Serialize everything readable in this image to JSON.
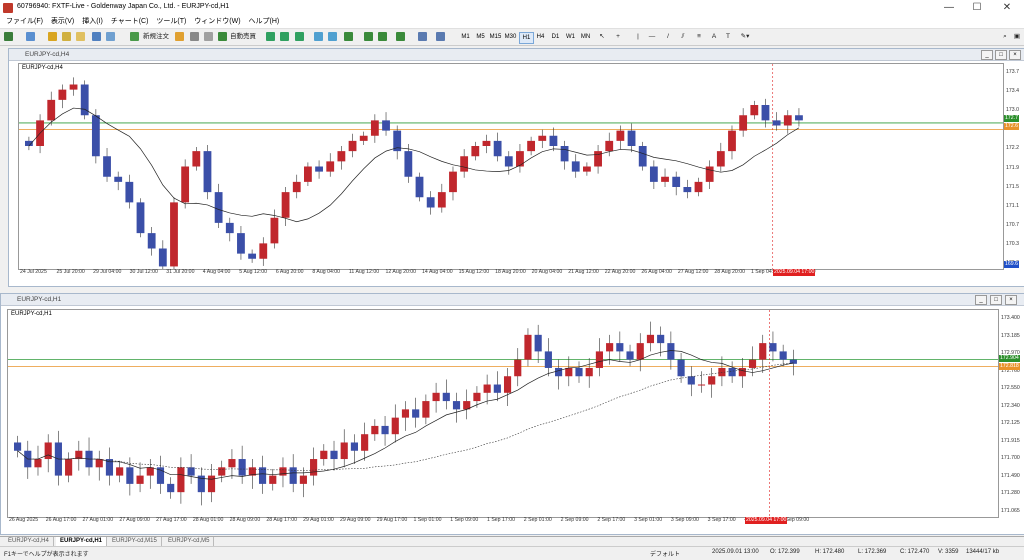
{
  "window": {
    "title": "60796940: FXTF-Live - Goldenway Japan Co., Ltd. - EURJPY-cd,H1"
  },
  "menu": [
    "ファイル(F)",
    "表示(V)",
    "挿入(I)",
    "チャート(C)",
    "ツール(T)",
    "ウィンドウ(W)",
    "ヘルプ(H)"
  ],
  "toolbar": {
    "new_order": "新規注文",
    "auto_trade": "自動売買",
    "timeframes": [
      "M1",
      "M5",
      "M15",
      "M30",
      "H1",
      "H4",
      "D1",
      "W1",
      "MN"
    ],
    "active_tf": "H1"
  },
  "colors": {
    "bull": "#c0272d",
    "bear": "#3b4fa8",
    "ma": "#222222",
    "green_line": "#2e9b3a",
    "orange_line": "#e8932b",
    "red_tag": "#e02020",
    "green_tag": "#2c8f2c",
    "blue_tag": "#2050c8"
  },
  "chart_top": {
    "window_title": "EURJPY-cd,H4",
    "label": "EURJPY-cd,H4",
    "y_ticks": [
      "173.7",
      "173.4",
      "173.0",
      "172.6",
      "172.2",
      "171.9",
      "171.5",
      "171.1",
      "170.7",
      "170.3",
      "170.0"
    ],
    "x_ticks": [
      "24 Jul 2025",
      "25 Jul 20:00",
      "29 Jul 04:00",
      "30 Jul 12:00",
      "31 Jul 20:00",
      "4 Aug 04:00",
      "5 Aug 12:00",
      "6 Aug 20:00",
      "8 Aug 04:00",
      "11 Aug 12:00",
      "12 Aug 20:00",
      "14 Aug 04:00",
      "15 Aug 12:00",
      "18 Aug 20:00",
      "20 Aug 04:00",
      "21 Aug 12:00",
      "22 Aug 20:00",
      "26 Aug 04:00",
      "27 Aug 12:00",
      "28 Aug 20:00",
      "1 Sep 04:00",
      "2 Sep 12:00"
    ],
    "time_tag": "2025.09.04 17:00",
    "price_green": "172.7",
    "price_orange": "172.6",
    "price_blue": "169.6",
    "chart_data": {
      "type": "candlestick",
      "ylim": [
        169.9,
        173.9
      ],
      "close": [
        172.3,
        172.8,
        173.2,
        173.4,
        173.5,
        172.9,
        172.1,
        171.7,
        171.6,
        171.2,
        170.6,
        170.3,
        169.95,
        171.2,
        171.9,
        172.2,
        171.4,
        170.8,
        170.6,
        170.2,
        170.1,
        170.4,
        170.9,
        171.4,
        171.6,
        171.9,
        171.8,
        172.0,
        172.2,
        172.4,
        172.5,
        172.8,
        172.6,
        172.2,
        171.7,
        171.3,
        171.1,
        171.4,
        171.8,
        172.1,
        172.3,
        172.4,
        172.1,
        171.9,
        172.2,
        172.4,
        172.5,
        172.3,
        172.0,
        171.8,
        171.9,
        172.2,
        172.4,
        172.6,
        172.3,
        171.9,
        171.6,
        171.7,
        171.5,
        171.4,
        171.6,
        171.9,
        172.2,
        172.6,
        172.9,
        173.1,
        172.8,
        172.7,
        172.9,
        172.8
      ]
    }
  },
  "chart_bottom": {
    "window_title": "EURJPY-cd,H1",
    "label": "EURJPY-cd,H1",
    "y_ticks": [
      "173.400",
      "173.185",
      "172.970",
      "172.760",
      "172.550",
      "172.340",
      "172.125",
      "171.915",
      "171.700",
      "171.490",
      "171.280",
      "171.065"
    ],
    "x_ticks": [
      "26 Aug 2025",
      "26 Aug 17:00",
      "27 Aug 01:00",
      "27 Aug 09:00",
      "27 Aug 17:00",
      "28 Aug 01:00",
      "28 Aug 09:00",
      "28 Aug 17:00",
      "29 Aug 01:00",
      "29 Aug 09:00",
      "29 Aug 17:00",
      "1 Sep 01:00",
      "1 Sep 09:00",
      "1 Sep 17:00",
      "2 Sep 01:00",
      "2 Sep 09:00",
      "2 Sep 17:00",
      "3 Sep 01:00",
      "3 Sep 09:00",
      "3 Sep 17:00",
      "4 Sep 01:00",
      "4 Sep 09:00"
    ],
    "time_tag": "2025.09.04 17:00",
    "price_green": "172.904",
    "price_orange": "172.818",
    "chart_data": {
      "type": "candlestick",
      "ylim": [
        171.0,
        173.5
      ],
      "close": [
        171.8,
        171.6,
        171.7,
        171.9,
        171.5,
        171.7,
        171.8,
        171.6,
        171.7,
        171.5,
        171.6,
        171.4,
        171.5,
        171.6,
        171.4,
        171.3,
        171.6,
        171.5,
        171.3,
        171.5,
        171.6,
        171.7,
        171.5,
        171.6,
        171.4,
        171.5,
        171.6,
        171.4,
        171.5,
        171.7,
        171.8,
        171.7,
        171.9,
        171.8,
        172.0,
        172.1,
        172.0,
        172.2,
        172.3,
        172.2,
        172.4,
        172.5,
        172.4,
        172.3,
        172.4,
        172.5,
        172.6,
        172.5,
        172.7,
        172.9,
        173.2,
        173.0,
        172.8,
        172.7,
        172.8,
        172.7,
        172.8,
        173.0,
        173.1,
        173.0,
        172.9,
        173.1,
        173.2,
        173.1,
        172.9,
        172.7,
        172.6,
        172.6,
        172.7,
        172.8,
        172.7,
        172.8,
        172.9,
        173.1,
        173.0,
        172.9,
        172.85
      ]
    }
  },
  "tabs": [
    "EURJPY-cd,H4",
    "EURJPY-cd,H1",
    "EURJPY-cd,M15",
    "EURJPY-cd,M5"
  ],
  "active_tab": "EURJPY-cd,H1",
  "status": {
    "help": "F1キーでヘルプが表示されます",
    "profile": "デフォルト",
    "datetime": "2025.09.01 13:00",
    "open": "O: 172.399",
    "high": "H: 172.480",
    "low": "L: 172.369",
    "close": "C: 172.470",
    "volume": "V: 3359",
    "traffic": "13444/17 kb"
  }
}
